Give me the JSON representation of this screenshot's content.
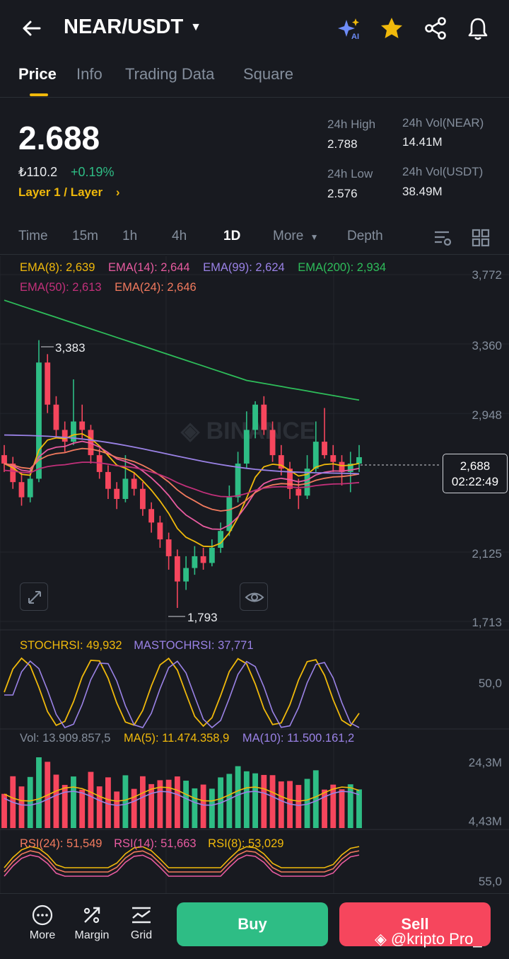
{
  "header": {
    "pair": "NEAR/USDT"
  },
  "tabs": [
    {
      "label": "Price",
      "active": true
    },
    {
      "label": "Info"
    },
    {
      "label": "Trading Data"
    },
    {
      "label": "Square"
    }
  ],
  "ticker": {
    "price": "2.688",
    "fiat": "₺110.2",
    "change": "+0.19%",
    "tag": "Layer 1 / Layer",
    "high_label": "24h High",
    "high": "2.788",
    "low_label": "24h Low",
    "low": "2.576",
    "vol_base_label": "24h Vol(NEAR)",
    "vol_base": "14.41M",
    "vol_quote_label": "24h Vol(USDT)",
    "vol_quote": "38.49M"
  },
  "intervals": [
    "Time",
    "15m",
    "1h",
    "4h",
    "1D",
    "More",
    "Depth"
  ],
  "active_interval": "1D",
  "ema": {
    "ema8": "EMA(8): 2,639",
    "ema14": "EMA(14): 2,644",
    "ema99": "EMA(99): 2,624",
    "ema200": "EMA(200): 2,934",
    "ema50": "EMA(50): 2,613",
    "ema24": "EMA(24): 2,646"
  },
  "colors": {
    "ema8": "#f0b90b",
    "ema14": "#e85ba0",
    "ema99": "#9a82e6",
    "ema200": "#2ebd5a",
    "ema50": "#c2307a",
    "ema24": "#f27a5e",
    "up": "#2ebd85",
    "down": "#f6465d"
  },
  "price_axis": [
    "3,772",
    "3,360",
    "2,948",
    "2,125",
    "1,713"
  ],
  "chart_marks": {
    "high": "3,383",
    "low": "1,793"
  },
  "price_tag": {
    "price": "2,688",
    "countdown": "02:22:49"
  },
  "stochrsi": {
    "label": "STOCHRSI: 49,932",
    "ma_label": "MASTOCHRSI: 37,771",
    "axis": "50,0"
  },
  "volume": {
    "label": "Vol: 13.909.857,5",
    "ma5": "MA(5): 11.474.358,9",
    "ma10": "MA(10): 11.500.161,2",
    "axis_top": "24,3M",
    "axis_bottom": "4,43M"
  },
  "rsi": {
    "rsi24": "RSI(24): 51,549",
    "rsi14": "RSI(14): 51,663",
    "rsi8": "RSI(8): 53,029",
    "axis": "55,0"
  },
  "bottom": {
    "more": "More",
    "margin": "Margin",
    "grid": "Grid",
    "buy": "Buy",
    "sell": "Sell",
    "watermark": "@kripto Pro_"
  },
  "chart_data": {
    "type": "candlestick",
    "ylim": [
      1713,
      3772
    ],
    "ticks": [
      3772,
      3360,
      2948,
      2125,
      1713
    ],
    "candles": [
      [
        2700,
        2650,
        2760,
        2600
      ],
      [
        2650,
        2540,
        2690,
        2500
      ],
      [
        2540,
        2450,
        2600,
        2400
      ],
      [
        2450,
        2560,
        2620,
        2420
      ],
      [
        2560,
        3250,
        3383,
        2540
      ],
      [
        3250,
        3000,
        3300,
        2950
      ],
      [
        3000,
        2850,
        3050,
        2800
      ],
      [
        2850,
        2780,
        2900,
        2720
      ],
      [
        2780,
        2900,
        3150,
        2760
      ],
      [
        2900,
        2850,
        3000,
        2800
      ],
      [
        2850,
        2700,
        2880,
        2650
      ],
      [
        2700,
        2600,
        2740,
        2560
      ],
      [
        2600,
        2500,
        2640,
        2440
      ],
      [
        2500,
        2440,
        2540,
        2380
      ],
      [
        2440,
        2560,
        2700,
        2420
      ],
      [
        2560,
        2500,
        2600,
        2460
      ],
      [
        2500,
        2380,
        2540,
        2340
      ],
      [
        2380,
        2300,
        2420,
        2240
      ],
      [
        2300,
        2200,
        2340,
        2150
      ],
      [
        2200,
        2100,
        2240,
        2020
      ],
      [
        2100,
        1950,
        2140,
        1793
      ],
      [
        1950,
        2030,
        2100,
        1900
      ],
      [
        2030,
        2100,
        2160,
        1990
      ],
      [
        2100,
        2060,
        2150,
        2020
      ],
      [
        2060,
        2150,
        2200,
        2040
      ],
      [
        2150,
        2250,
        2300,
        2120
      ],
      [
        2250,
        2450,
        2520,
        2220
      ],
      [
        2450,
        2650,
        2720,
        2420
      ],
      [
        2650,
        2850,
        2960,
        2620
      ],
      [
        2850,
        3000,
        3020,
        2800
      ],
      [
        3000,
        2850,
        3050,
        2820
      ],
      [
        2850,
        2700,
        2900,
        2660
      ],
      [
        2700,
        2620,
        2760,
        2580
      ],
      [
        2620,
        2500,
        2660,
        2440
      ],
      [
        2500,
        2460,
        2560,
        2380
      ],
      [
        2460,
        2620,
        2700,
        2440
      ],
      [
        2620,
        2780,
        2900,
        2600
      ],
      [
        2780,
        2700,
        2980,
        2680
      ],
      [
        2700,
        2660,
        2760,
        2600
      ],
      [
        2660,
        2600,
        2700,
        2520
      ],
      [
        2600,
        2650,
        2720,
        2480
      ],
      [
        2650,
        2688,
        2760,
        2600
      ]
    ]
  }
}
